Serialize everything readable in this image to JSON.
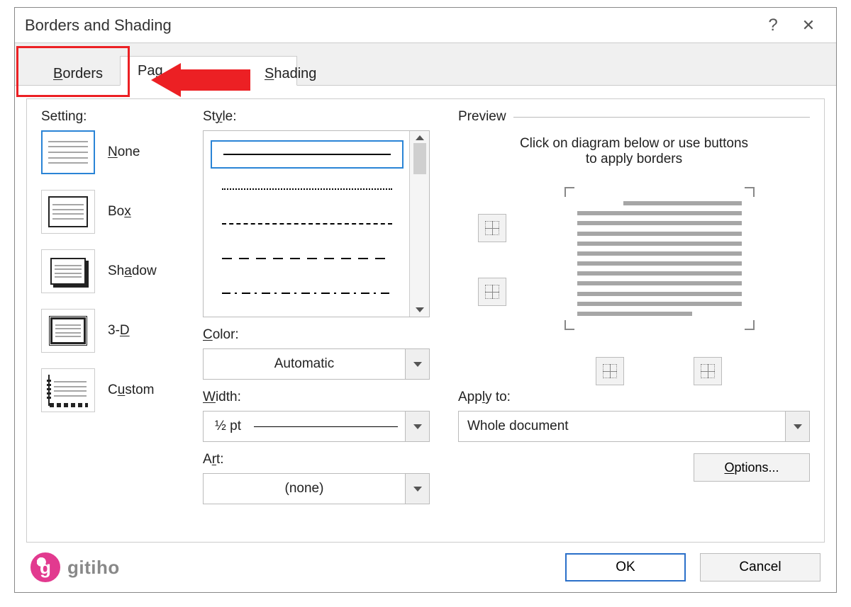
{
  "dialog": {
    "title": "Borders and Shading",
    "help_symbol": "?"
  },
  "tabs": {
    "borders": "Borders",
    "page_border": "Page Border",
    "shading": "Shading",
    "page_border_visible_fragment_left": "Pag",
    "page_border_visible_fragment_right": "Shading"
  },
  "setting": {
    "label": "Setting:",
    "none": "None",
    "box": "Box",
    "shadow": "Shadow",
    "threed": "3-D",
    "custom": "Custom"
  },
  "style": {
    "label": "Style:"
  },
  "color": {
    "label": "Color:",
    "value": "Automatic"
  },
  "width": {
    "label": "Width:",
    "value": "½ pt"
  },
  "art": {
    "label": "Art:",
    "value": "(none)"
  },
  "preview": {
    "label": "Preview",
    "hint_line1": "Click on diagram below or use buttons",
    "hint_line2": "to apply borders"
  },
  "apply": {
    "label": "Apply to:",
    "value": "Whole document"
  },
  "buttons": {
    "options": "Options...",
    "ok": "OK",
    "cancel": "Cancel"
  },
  "branding": {
    "text": "gitiho",
    "glyph": "g"
  }
}
